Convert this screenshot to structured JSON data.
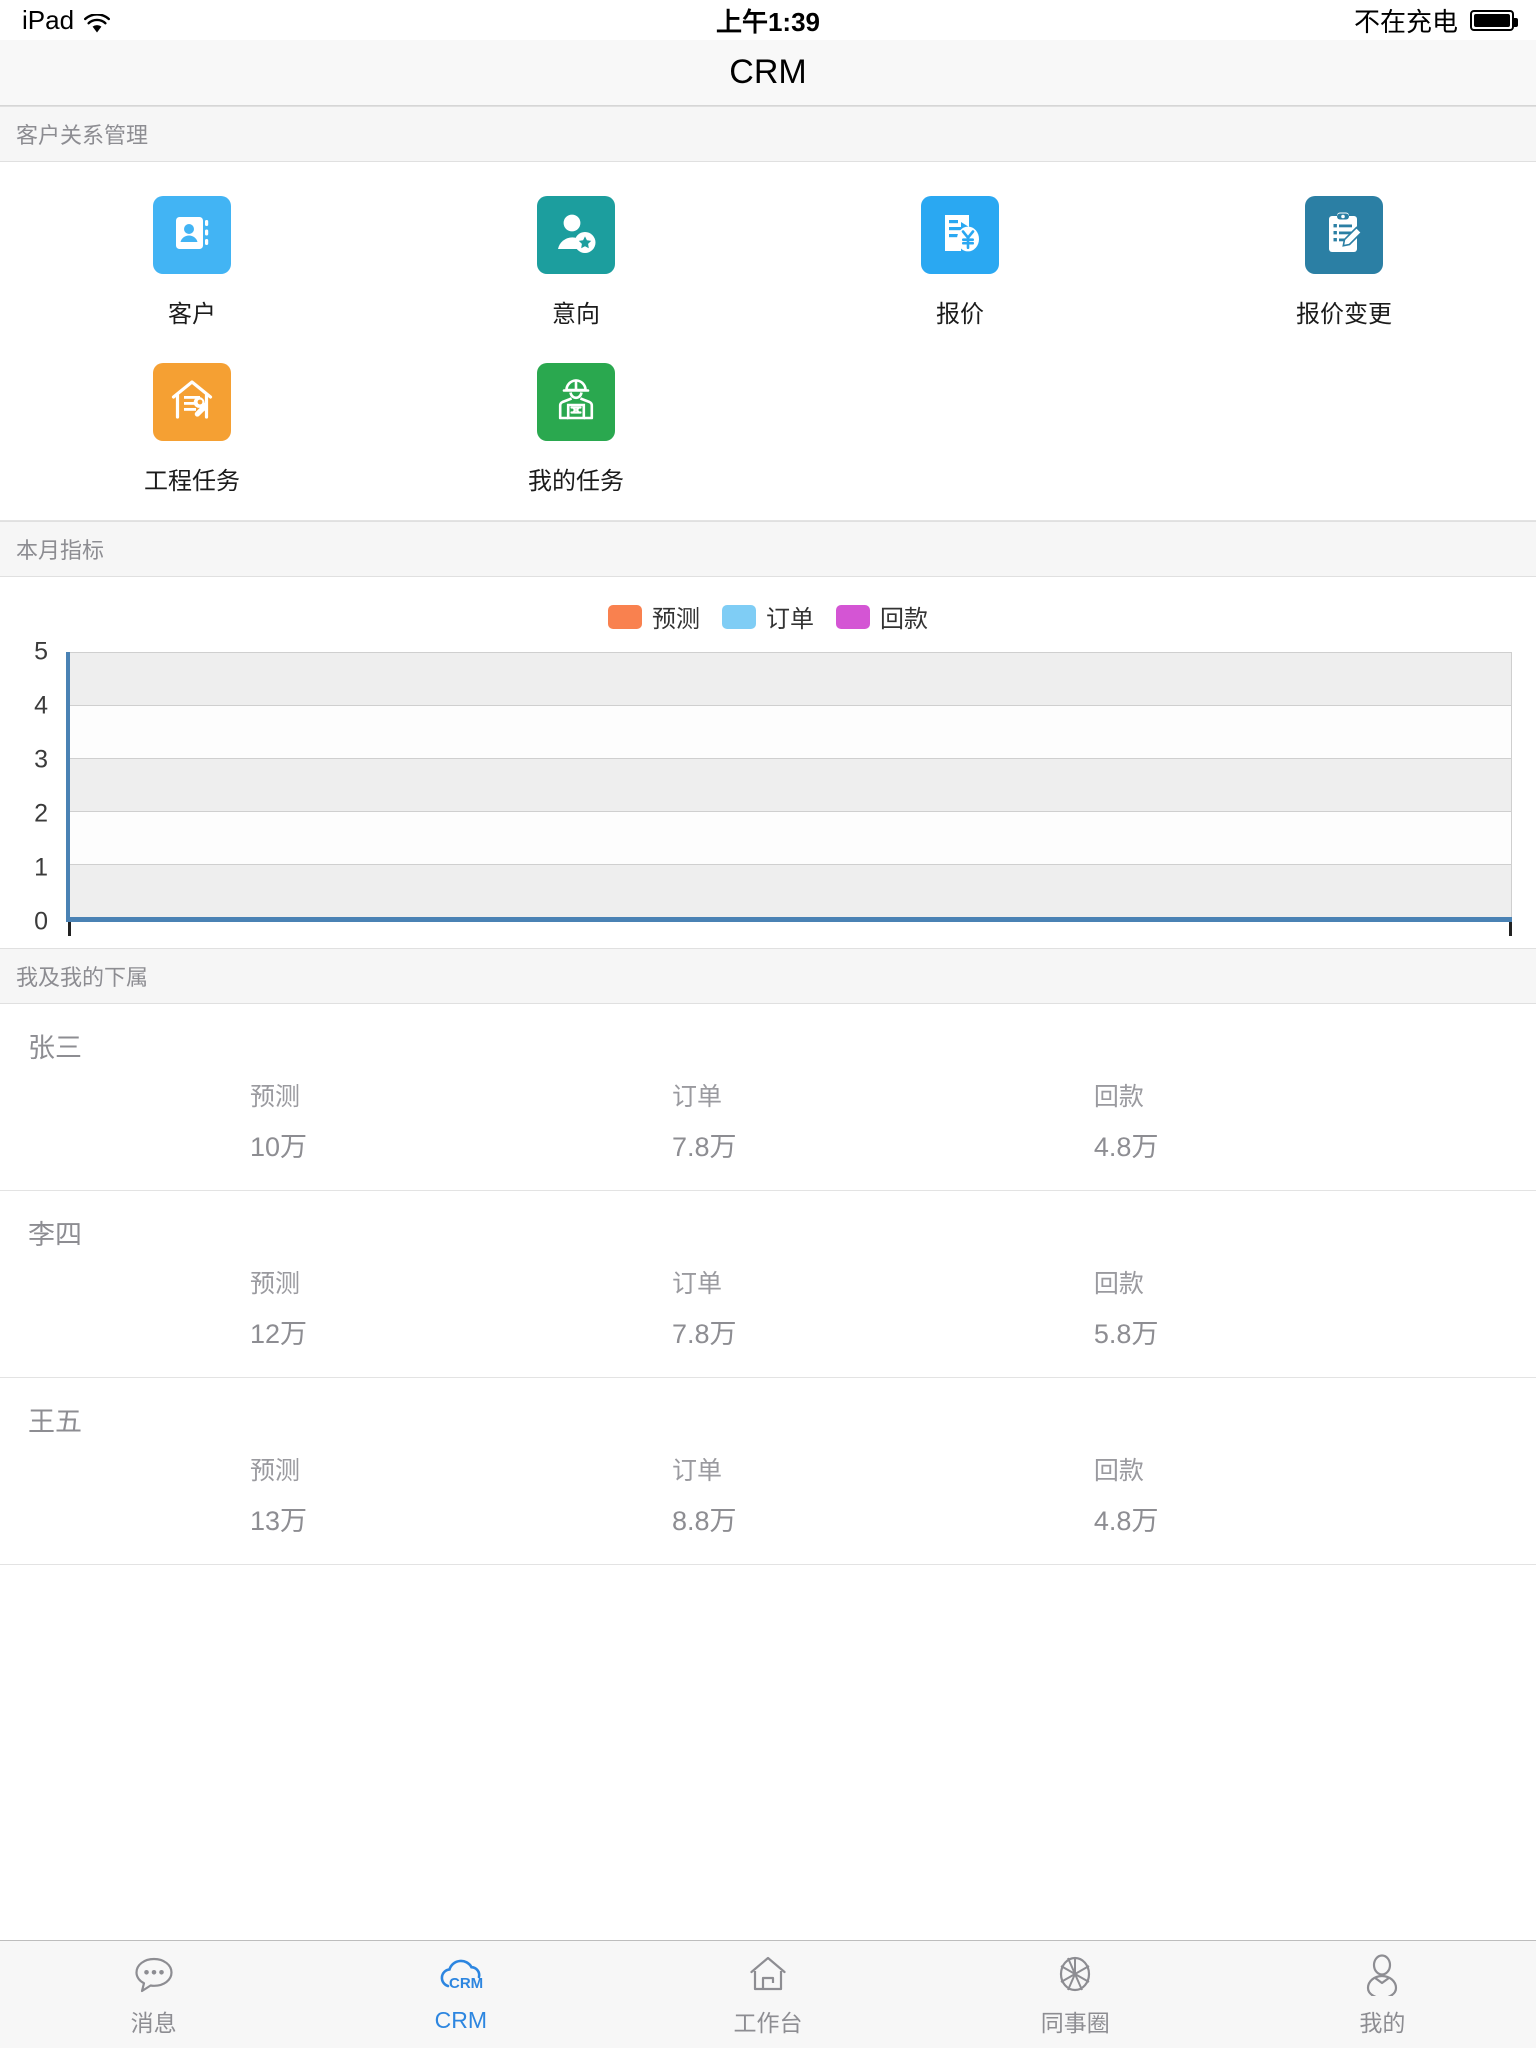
{
  "statusbar": {
    "device": "iPad",
    "wifi_icon": "wifi-icon",
    "time": "上午1:39",
    "battery_text": "不在充电",
    "battery_icon": "battery-full-icon"
  },
  "navbar": {
    "title": "CRM"
  },
  "apps_section": {
    "header": "客户关系管理",
    "items": [
      {
        "label": "客户",
        "icon": "contact-book-icon",
        "color": "#42b4f4"
      },
      {
        "label": "意向",
        "icon": "user-star-icon",
        "color": "#1c9e9e"
      },
      {
        "label": "报价",
        "icon": "invoice-yen-icon",
        "color": "#2aa8f2"
      },
      {
        "label": "报价变更",
        "icon": "clipboard-edit-icon",
        "color": "#2b7fa4"
      },
      {
        "label": "工程任务",
        "icon": "house-wrench-icon",
        "color": "#f5a033"
      },
      {
        "label": "我的任务",
        "icon": "worker-icon",
        "color": "#2aa84f"
      }
    ]
  },
  "metrics_section": {
    "header": "本月指标"
  },
  "chart_data": {
    "type": "bar",
    "title": "本月指标",
    "categories": [],
    "series": [
      {
        "name": "预测",
        "color": "#f9814f",
        "values": []
      },
      {
        "name": "订单",
        "color": "#7fcdf5",
        "values": []
      },
      {
        "name": "回款",
        "color": "#d455d4",
        "values": []
      }
    ],
    "legend": [
      "预测",
      "订单",
      "回款"
    ],
    "legend_position": "top-center",
    "xlabel": "",
    "ylabel": "",
    "ylim": [
      0,
      5
    ],
    "yticks": [
      5,
      4,
      3,
      2,
      1,
      0
    ],
    "grid": true,
    "band_shading": [
      "grey",
      "white",
      "grey",
      "white",
      "grey"
    ],
    "axis_color": "#4a82b4"
  },
  "people_section": {
    "header": "我及我的下属",
    "columns": [
      "预测",
      "订单",
      "回款"
    ],
    "rows": [
      {
        "name": "张三",
        "forecast": "10万",
        "order": "7.8万",
        "payment": "4.8万"
      },
      {
        "name": "李四",
        "forecast": "12万",
        "order": "7.8万",
        "payment": "5.8万"
      },
      {
        "name": "王五",
        "forecast": "13万",
        "order": "8.8万",
        "payment": "4.8万"
      }
    ]
  },
  "tabbar": {
    "active_color": "#2d86e0",
    "inactive_color": "#8d8d92",
    "items": [
      {
        "label": "消息",
        "icon": "chat-bubble-icon",
        "active": false
      },
      {
        "label": "CRM",
        "icon": "crm-cloud-icon",
        "active": true
      },
      {
        "label": "工作台",
        "icon": "home-icon",
        "active": false
      },
      {
        "label": "同事圈",
        "icon": "aperture-icon",
        "active": false
      },
      {
        "label": "我的",
        "icon": "person-icon",
        "active": false
      }
    ]
  }
}
